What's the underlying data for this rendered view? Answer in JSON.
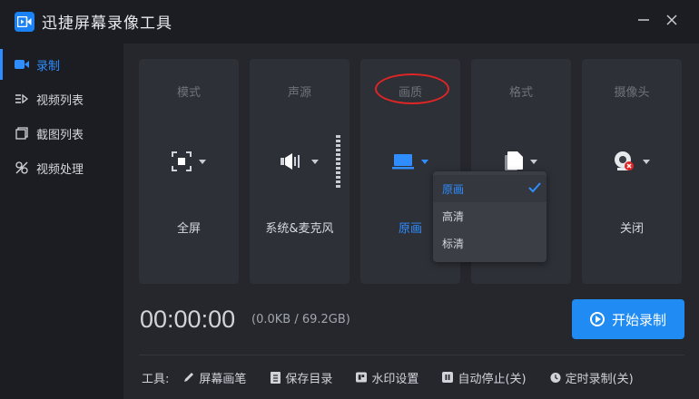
{
  "app": {
    "title": "迅捷屏幕录像工具",
    "accent": "#2f8dff"
  },
  "window": {
    "minimize_icon": "minimize-icon",
    "close_icon": "close-icon"
  },
  "sidebar": {
    "items": [
      {
        "label": "录制",
        "icon": "video-camera-icon",
        "active": true
      },
      {
        "label": "视频列表",
        "icon": "video-list-icon",
        "active": false
      },
      {
        "label": "截图列表",
        "icon": "screenshot-list-icon",
        "active": false
      },
      {
        "label": "视频处理",
        "icon": "video-process-icon",
        "active": false
      }
    ]
  },
  "settings": {
    "mode": {
      "title": "模式",
      "value": "全屏",
      "icon": "fullscreen-icon"
    },
    "audio": {
      "title": "声源",
      "value": "系统&麦克风",
      "icon": "speaker-icon"
    },
    "quality": {
      "title": "画质",
      "value": "原画",
      "icon": "monitor-icon"
    },
    "format": {
      "title": "格式",
      "icon": "file-icon"
    },
    "camera": {
      "title": "摄像头",
      "value": "关闭",
      "icon": "webcam-off-icon"
    }
  },
  "quality_dropdown": {
    "options": [
      "原画",
      "高清",
      "标清"
    ],
    "selected": "原画"
  },
  "recorder": {
    "timer": "00:00:00",
    "filesize": "(0.0KB / 69.2GB)",
    "start_label": "开始录制"
  },
  "tools": {
    "label": "工具:",
    "items": [
      {
        "label": "屏幕画笔",
        "icon": "pen-icon"
      },
      {
        "label": "保存目录",
        "icon": "folder-icon"
      },
      {
        "label": "水印设置",
        "icon": "watermark-icon"
      },
      {
        "label": "自动停止(关)",
        "icon": "auto-stop-icon"
      },
      {
        "label": "定时录制(关)",
        "icon": "clock-icon"
      }
    ]
  }
}
